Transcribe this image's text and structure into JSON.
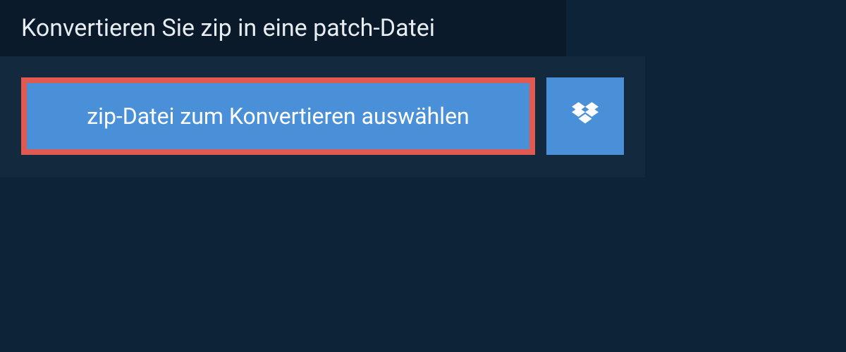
{
  "header": {
    "title": "Konvertieren Sie zip in eine patch-Datei"
  },
  "actions": {
    "select_file_label": "zip-Datei zum Konvertieren auswählen"
  },
  "colors": {
    "page_bg": "#0d2438",
    "header_bg": "#0a1a2a",
    "panel_bg": "#13293d",
    "button_bg": "#4a90d9",
    "highlight_border": "#e05a52",
    "text_light": "#e8edf2"
  }
}
